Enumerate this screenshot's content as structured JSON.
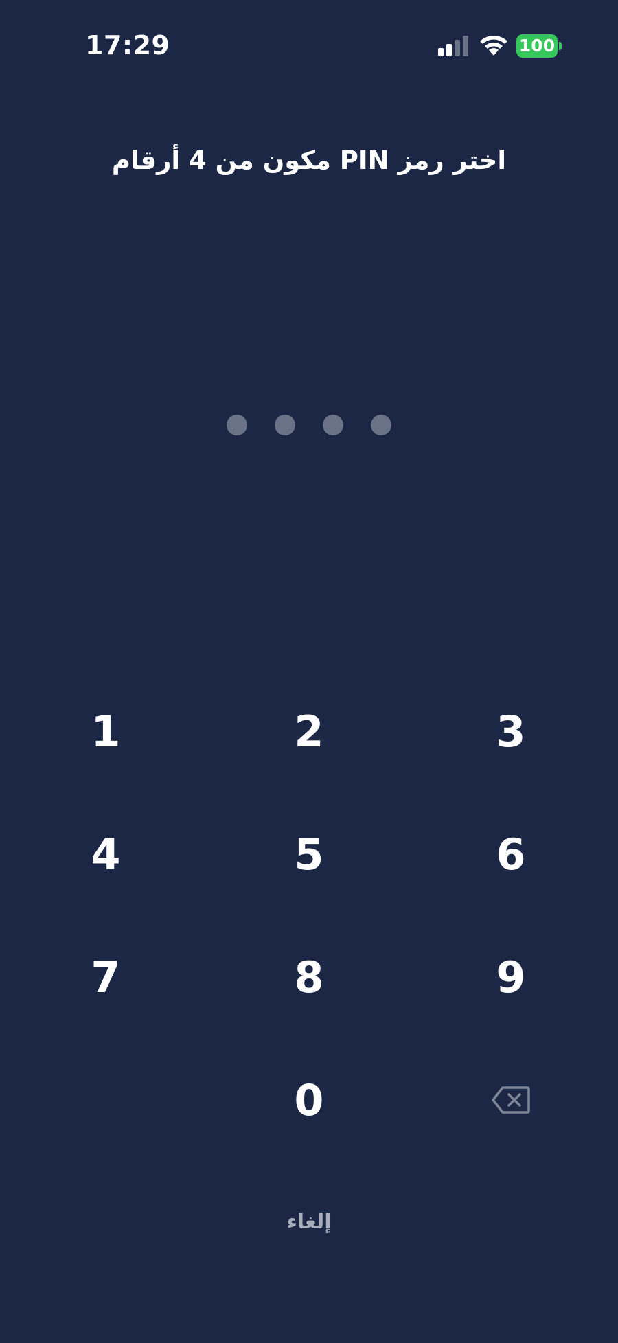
{
  "status_bar": {
    "time": "17:29",
    "battery": "100",
    "icons": [
      "signal-icon",
      "wifi-icon",
      "battery-icon"
    ]
  },
  "prompt": "اختر رمز PIN مكون من 4 أرقام",
  "pin": {
    "length": 4,
    "entered": 0
  },
  "keypad": {
    "k1": "1",
    "k2": "2",
    "k3": "3",
    "k4": "4",
    "k5": "5",
    "k6": "6",
    "k7": "7",
    "k8": "8",
    "k9": "9",
    "k0": "0",
    "backspace_icon": "backspace-icon"
  },
  "cancel_label": "إلغاء",
  "colors": {
    "background": "#1b2745",
    "pin_dot_empty": "#6a7287",
    "battery": "#35c759",
    "cancel_text": "#a7adbb",
    "backspace": "#7e8597"
  }
}
